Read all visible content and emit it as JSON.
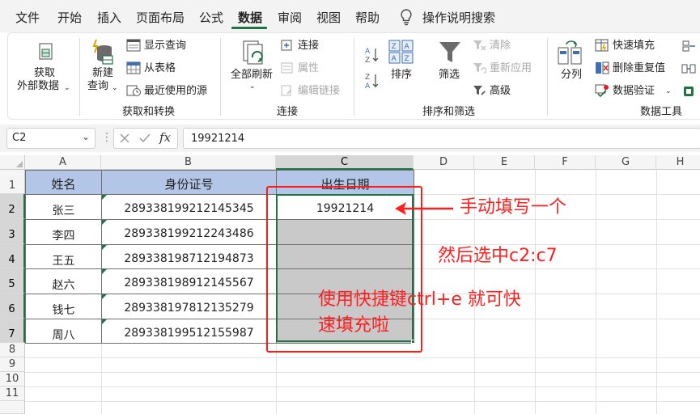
{
  "menu": {
    "items": [
      "文件",
      "开始",
      "插入",
      "页面布局",
      "公式",
      "数据",
      "审阅",
      "视图",
      "帮助"
    ],
    "active": "数据",
    "search_label": "操作说明搜索"
  },
  "ribbon": {
    "get_external_data_line1": "获取",
    "get_external_data_line2": "外部数据",
    "new_query_line1": "新建",
    "new_query_line2": "查询",
    "show_queries": "显示查询",
    "from_table": "从表格",
    "recent_sources": "最近使用的源",
    "group_get_transform": "获取和转换",
    "refresh_all": "全部刷新",
    "connections": "连接",
    "properties": "属性",
    "edit_links": "编辑链接",
    "group_connections": "连接",
    "sort": "排序",
    "filter": "筛选",
    "clear": "清除",
    "reapply": "重新应用",
    "advanced": "高级",
    "group_sort_filter": "排序和筛选",
    "text_to_columns": "分列",
    "flash_fill": "快速填充",
    "remove_duplicates": "删除重复值",
    "data_validation": "数据验证",
    "group_data_tools": "数据工具"
  },
  "formula_bar": {
    "name_box": "C2",
    "fx": "fx",
    "value": "19921214"
  },
  "grid": {
    "columns": [
      "A",
      "B",
      "C",
      "D",
      "E",
      "F",
      "G",
      "H"
    ],
    "rows": [
      "1",
      "2",
      "3",
      "4",
      "5",
      "6",
      "7",
      "8",
      "9",
      "10",
      "11"
    ],
    "headers": [
      "姓名",
      "身份证号",
      "出生日期"
    ],
    "data": [
      [
        "张三",
        "289338199212145345",
        "19921214"
      ],
      [
        "李四",
        "289338199212243486",
        ""
      ],
      [
        "王五",
        "289338198712194873",
        ""
      ],
      [
        "赵六",
        "289338198912145567",
        ""
      ],
      [
        "钱七",
        "289338197812135279",
        ""
      ],
      [
        "周八",
        "289338199512155987",
        ""
      ]
    ]
  },
  "annotations": {
    "manual_fill": "手动填写一个",
    "select_range": "然后选中c2:c7",
    "shortcut_line1": "使用快捷键ctrl+e  就可快",
    "shortcut_line2": "速填充啦"
  },
  "colors": {
    "accent_green": "#217346",
    "header_fill": "#b4c6e7",
    "annotation_red": "#ff1f1f",
    "selection_grey": "#c9c9c9"
  }
}
